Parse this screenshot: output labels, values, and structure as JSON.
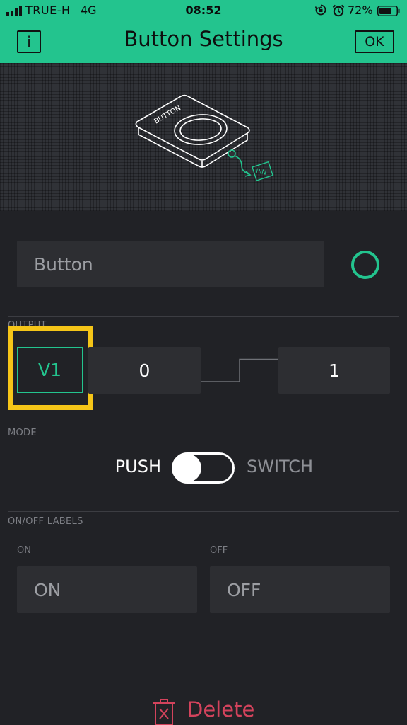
{
  "status_bar": {
    "carrier": "TRUE-H",
    "network": "4G",
    "time": "08:52",
    "battery_percent": "72%",
    "battery_level": 0.72,
    "icons": [
      "signal-icon",
      "rotation-lock-icon",
      "alarm-icon",
      "battery-icon"
    ]
  },
  "header": {
    "title": "Button Settings",
    "info_label": "i",
    "ok_label": "OK",
    "background": "#23c48e"
  },
  "preview": {
    "device_label": "BUTTON",
    "pin_label": "PIN"
  },
  "widget": {
    "name_value": "Button",
    "color": "#23c48e"
  },
  "output": {
    "section_label": "OUTPUT",
    "pin": "V1",
    "low_value": "0",
    "high_value": "1",
    "highlight_color": "#f5c518"
  },
  "mode": {
    "section_label": "MODE",
    "push_label": "PUSH",
    "switch_label": "SWITCH",
    "selected": "PUSH"
  },
  "onoff": {
    "section_label": "ON/OFF LABELS",
    "on_label": "ON",
    "off_label": "OFF",
    "on_value": "ON",
    "off_value": "OFF"
  },
  "delete": {
    "label": "Delete",
    "color": "#d3435c"
  }
}
